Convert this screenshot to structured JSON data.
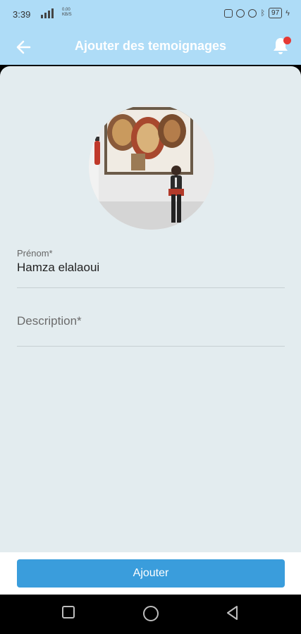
{
  "status_bar": {
    "time": "3:39",
    "net_speed": "0.00",
    "net_unit": "KB/S",
    "battery": "97"
  },
  "app_bar": {
    "title": "Ajouter des temoignages",
    "back_icon": "arrow-left-icon",
    "notification_icon": "bell-icon",
    "notification_dot_color": "#e53935"
  },
  "avatar": {
    "description_icon": "profile-photo"
  },
  "form": {
    "prenom_label": "Prénom*",
    "prenom_value": "Hamza elalaoui",
    "description_placeholder": "Description*"
  },
  "actions": {
    "submit_label": "Ajouter"
  },
  "colors": {
    "app_bar": "#aedcf7",
    "content_bg": "#e3ecef",
    "button": "#3a9ddc"
  }
}
